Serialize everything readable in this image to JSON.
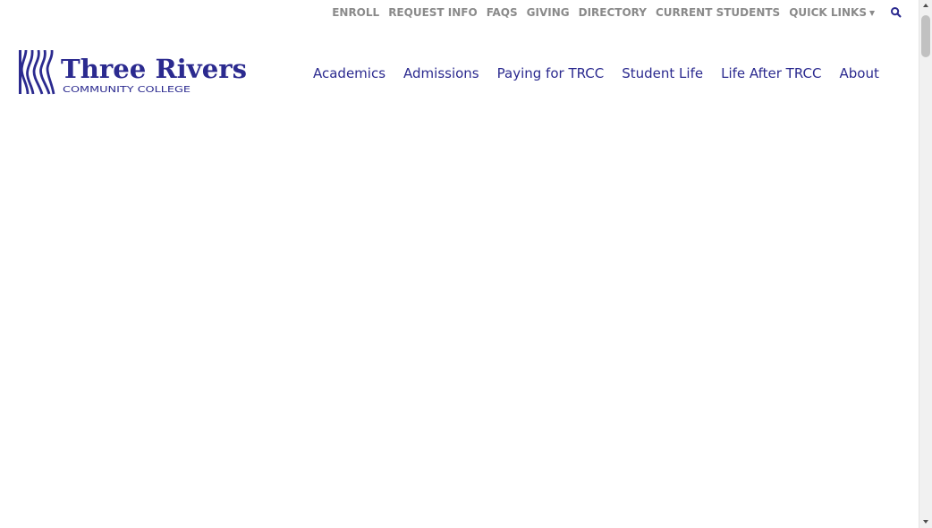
{
  "brand": {
    "name": "Three Rivers",
    "tagline": "COMMUNITY COLLEGE",
    "color": "#2b2a8f"
  },
  "utility_nav": {
    "items": [
      "ENROLL",
      "REQUEST INFO",
      "FAQS",
      "GIVING",
      "DIRECTORY",
      "CURRENT STUDENTS"
    ],
    "quick_links_label": "QUICK LINKS",
    "color": "#8a8a8a",
    "search_icon": "search-icon"
  },
  "main_nav": {
    "items": [
      "Academics",
      "Admissions",
      "Paying for TRCC",
      "Student Life",
      "Life After TRCC",
      "About"
    ],
    "color": "#2b2a8f"
  }
}
